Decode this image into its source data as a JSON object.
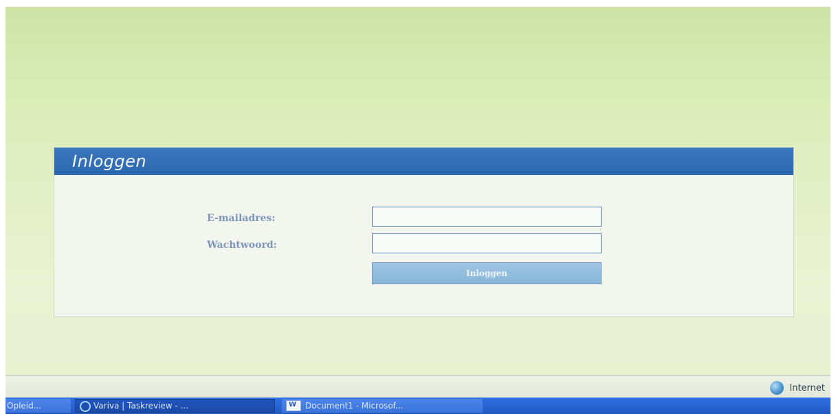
{
  "login": {
    "title": "Inloggen",
    "email_label": "E-mailadres:",
    "password_label": "Wachtwoord:",
    "email_value": "",
    "password_value": "",
    "button_label": "Inloggen"
  },
  "status_bar": {
    "zone_icon": "globe-icon",
    "zone_text": "Internet"
  },
  "taskbar": {
    "items": [
      {
        "label": "Opleid...",
        "icon": ""
      },
      {
        "label": "Variva | Taskreview - ...",
        "icon": "ie-icon"
      },
      {
        "label": "Document1 - Microsof...",
        "icon": "word-icon"
      }
    ]
  },
  "colors": {
    "header_blue": "#2b67ae",
    "label_blue": "#7d97bb",
    "button_blue": "#88b6d8",
    "taskbar_blue": "#2a64d1"
  }
}
